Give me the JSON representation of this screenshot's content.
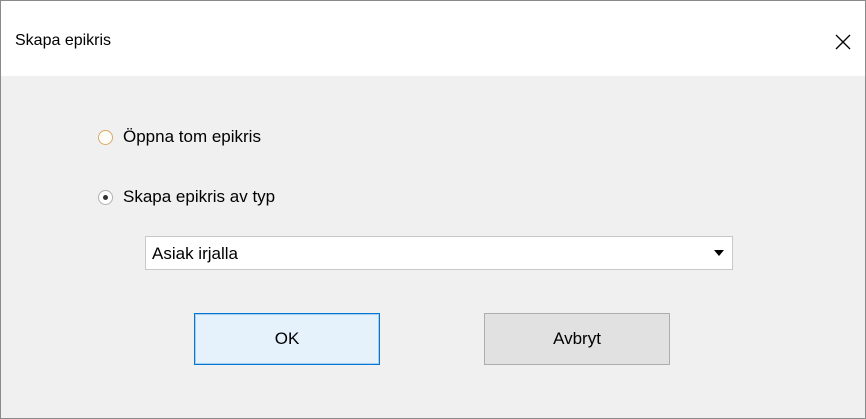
{
  "window": {
    "title": "Skapa epikris",
    "close_icon": "close-icon"
  },
  "options": {
    "open_empty_label": "Öppna tom epikris",
    "open_empty_selected": false,
    "create_by_type_label": "Skapa epikris av typ",
    "create_by_type_selected": true
  },
  "type_select": {
    "value": "Asiak irjalla",
    "arrow_icon": "dropdown-arrow-icon"
  },
  "buttons": {
    "ok_label": "OK",
    "cancel_label": "Avbryt"
  },
  "colors": {
    "focus_border": "#0078d7",
    "focus_fill": "#e5f1fb",
    "button_fill": "#e1e1e1",
    "background": "#f0f0f0"
  }
}
